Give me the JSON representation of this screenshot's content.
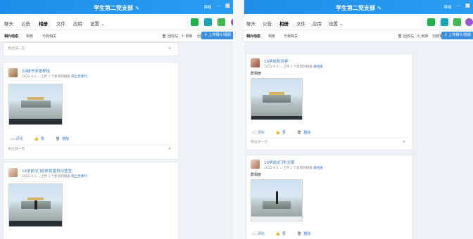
{
  "app": {
    "title": "学生第二党支部"
  },
  "window_controls": [
    "带组",
    "—",
    "⬜"
  ],
  "nav": {
    "tabs": [
      "聊天",
      "公告",
      "相册",
      "文件",
      "应用",
      "设置"
    ],
    "settings_suffix": "⌄"
  },
  "subnav": {
    "tabs": [
      "相片动态",
      "相册",
      "与我相关"
    ],
    "actions": [
      "回收站",
      "刷新",
      "创建相册"
    ],
    "upload": "上传相片/视频"
  },
  "comment_placeholder": "我也说一句",
  "send_icon": "✈",
  "left": {
    "posts": [
      {
        "name": "19秘书学张梓怡",
        "date": "2022-4-1",
        "meta_middle": "上传 1 个新增到相册",
        "album": "网上党课列",
        "actions": [
          "评论",
          "赞",
          "删除"
        ]
      },
      {
        "name": "19学前3门班体育委员孙莹莹",
        "date": "2022-4-1",
        "meta_middle": "上传 1 个新增到相册",
        "album": "网上党课列"
      }
    ]
  },
  "right": {
    "posts": [
      {
        "name": "19学前张玲祥",
        "date": "2022-4-1",
        "meta_middle": "上传 1 个新增到相册",
        "album": "群相册",
        "text": "群相册",
        "actions": [
          "评论",
          "赞",
          "删除"
        ]
      },
      {
        "name": "19学前3门牛文豪",
        "date": "2022-4-1",
        "meta_middle": "上传 1 个新增到相册",
        "album": "群相册",
        "text": "群相册",
        "actions": [
          "评论",
          "赞",
          "删除"
        ]
      }
    ]
  },
  "colors": {
    "accent": "#1f8eea",
    "link": "#3577c9",
    "call": "#22b14c",
    "video": "#1aa6b7",
    "note": "#3fb950",
    "add": "#9b59d0"
  }
}
